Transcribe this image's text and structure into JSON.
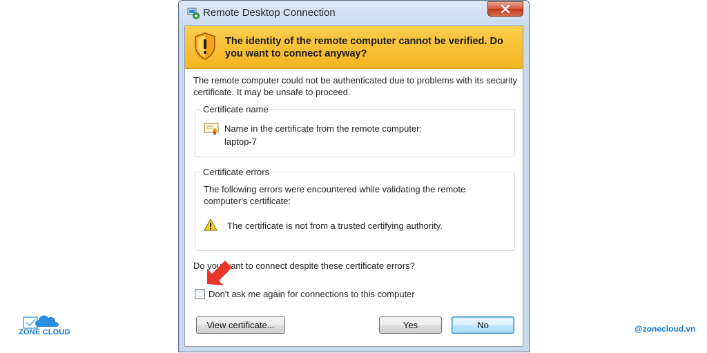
{
  "window": {
    "title": "Remote Desktop Connection",
    "close_label": "✕"
  },
  "banner": {
    "text": "The identity of the remote computer cannot be verified. Do you want to connect anyway?"
  },
  "intro_text": "The remote computer could not be authenticated due to problems with its security certificate. It may be unsafe to proceed.",
  "certificate_name": {
    "label": "Certificate name",
    "line1": "Name in the certificate from the remote computer:",
    "line2": "laptop-7"
  },
  "certificate_errors": {
    "label": "Certificate errors",
    "description": "The following errors were encountered while validating the remote computer's certificate:",
    "error": "The certificate is not from a trusted certifying authority."
  },
  "question": "Do you want to connect despite these certificate errors?",
  "checkbox": {
    "label": "Don't ask me again for connections to this computer",
    "checked": false
  },
  "buttons": {
    "view": "View certificate...",
    "yes": "Yes",
    "no": "No"
  },
  "branding": {
    "logo": "ZONE CLOUD",
    "handle": "@zonecloud.vn"
  },
  "colors": {
    "banner": "#f4b41f",
    "arrow": "#e8352a",
    "brand": "#1478c8"
  },
  "icons": [
    "rdc-app-icon",
    "shield-warning-icon",
    "certificate-icon",
    "warning-icon",
    "red-arrow-icon",
    "cloud-logo-icon"
  ]
}
